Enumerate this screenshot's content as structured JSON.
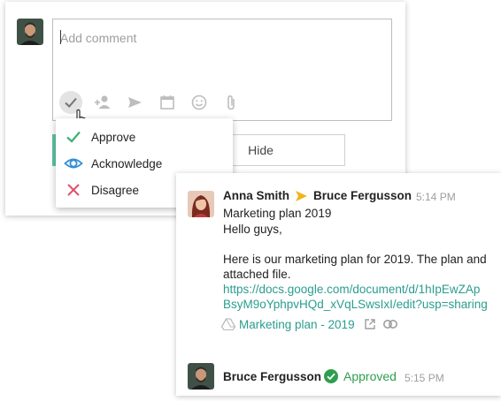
{
  "composer": {
    "placeholder": "Add comment",
    "toolbar_icons": [
      "checkmark-icon",
      "add-person-icon",
      "send-icon",
      "calendar-icon",
      "emoji-icon",
      "attachment-icon"
    ],
    "hide_label": "Hide"
  },
  "reaction_menu": {
    "items": [
      {
        "label": "Approve",
        "icon": "checkmark-icon",
        "color": "#3cb371"
      },
      {
        "label": "Acknowledge",
        "icon": "eye-icon",
        "color": "#2f8fd6"
      },
      {
        "label": "Disagree",
        "icon": "x-icon",
        "color": "#e0506e"
      }
    ]
  },
  "thread": {
    "message": {
      "sender": "Anna Smith",
      "recipient": "Bruce Fergusson",
      "time": "5:14 PM",
      "lines": [
        "Marketing plan 2019",
        "Hello guys,",
        "Here is our marketing plan for 2019. The plan and",
        "attached file."
      ],
      "link_lines": [
        "https://docs.google.com/document/d/1hIpEwZAp",
        "BsyM9oYphpvHQd_xVqLSwsIxI/edit?usp=sharing"
      ],
      "attachment": "Marketing plan - 2019"
    },
    "approval": {
      "name": "Bruce Fergusson",
      "status": "Approved",
      "time": "5:15 PM"
    }
  },
  "colors": {
    "accent_teal": "#2a9d8f",
    "approved_green": "#2e9e4f",
    "arrow_yellow": "#f2b41c"
  }
}
